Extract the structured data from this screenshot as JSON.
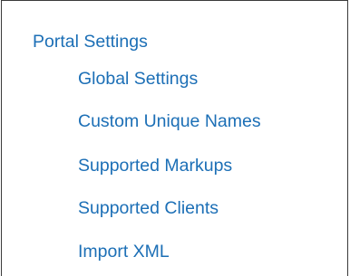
{
  "nav": {
    "root_label": "Portal Settings",
    "items": [
      {
        "label": "Global Settings"
      },
      {
        "label": "Custom Unique Names"
      },
      {
        "label": "Supported Markups"
      },
      {
        "label": "Supported Clients"
      },
      {
        "label": "Import XML"
      }
    ]
  },
  "colors": {
    "link": "#1c6fb6",
    "border": "#3a3a3a",
    "background": "#ffffff"
  }
}
